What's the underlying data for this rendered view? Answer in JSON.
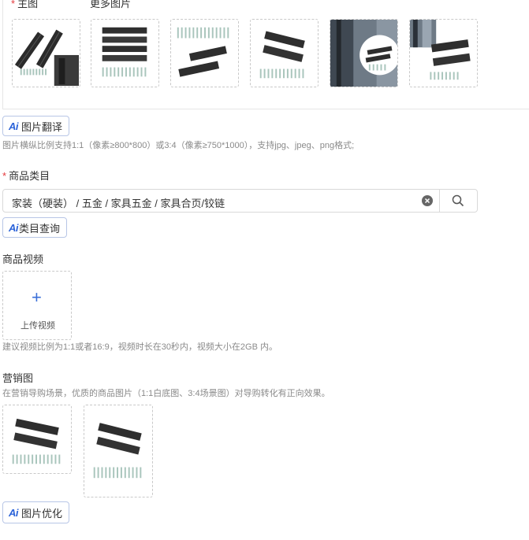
{
  "main_images": {
    "main_label": "主图",
    "more_label": "更多图片",
    "thumbs": [
      {
        "name": "hinge-product-photo-1"
      },
      {
        "name": "hinge-product-photo-2"
      },
      {
        "name": "hinge-product-photo-3"
      },
      {
        "name": "hinge-product-photo-4"
      },
      {
        "name": "hinge-installed-photo-5"
      },
      {
        "name": "hinge-installed-photo-6"
      }
    ]
  },
  "translate_button": {
    "ai": "Ai",
    "label": "图片翻译"
  },
  "image_hint": "图片横纵比例支持1:1（像素≥800*800）或3:4（像素≥750*1000），支持jpg、jpeg、png格式;",
  "category": {
    "label": "商品类目",
    "value": "家装（硬装） / 五金 / 家具五金 / 家具合页/铰链"
  },
  "category_query_button": {
    "ai": "Ai",
    "label": "类目查询"
  },
  "video": {
    "label": "商品视频",
    "plus": "+",
    "upload_label": "上传视频",
    "hint": "建议视频比例为1:1或者16:9，视频时长在30秒内，视频大小在2GB 内。"
  },
  "marketing": {
    "label": "营销图",
    "hint": "在营销导购场景，优质的商品图片（1:1白底图、3:4场景图）对导购转化有正向效果。"
  },
  "optimize_button": {
    "ai": "Ai",
    "label": "图片优化"
  },
  "colors": {
    "required": "#e4393c",
    "ai_blue": "#2b63d9",
    "plus_blue": "#3a6fd8"
  }
}
